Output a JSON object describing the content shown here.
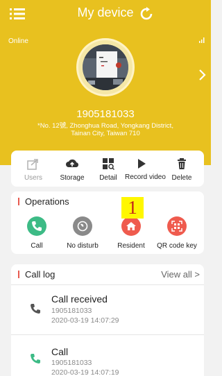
{
  "header": {
    "title": "My device",
    "status": "Online",
    "phone": "1905181033",
    "address": "*No. 12號, Zhonghua Road, Yongkang District, Tainan City, Taiwan 710",
    "icons": {
      "menu": "menu-icon",
      "refresh": "refresh-icon",
      "signal": "signal-icon",
      "next": "chevron-right-icon"
    }
  },
  "actions": [
    {
      "label": "Users",
      "icon": "share-icon",
      "disabled": true
    },
    {
      "label": "Storage",
      "icon": "cloud-upload-icon",
      "disabled": false
    },
    {
      "label": "Detail",
      "icon": "detail-icon",
      "disabled": false
    },
    {
      "label": "Record video",
      "icon": "play-icon",
      "disabled": false
    },
    {
      "label": "Delete",
      "icon": "trash-icon",
      "disabled": false
    }
  ],
  "operations": {
    "title": "Operations",
    "items": [
      {
        "label": "Call",
        "icon": "phone-icon",
        "color": "#3dbb86"
      },
      {
        "label": "No disturb",
        "icon": "no-disturb-icon",
        "color": "#8a8a8a"
      },
      {
        "label": "Resident",
        "icon": "home-icon",
        "color": "#ef5b4e"
      },
      {
        "label": "QR code key",
        "icon": "qr-code-icon",
        "color": "#ef5b4e"
      }
    ]
  },
  "annotation": {
    "badge": "1"
  },
  "call_log": {
    "title": "Call log",
    "view_all": "View all >",
    "items": [
      {
        "type": "Call received",
        "number": "1905181033",
        "time": "2020-03-19 14:07:29"
      },
      {
        "type": "Call",
        "number": "1905181033",
        "time": "2020-03-19 14:07:19"
      }
    ]
  },
  "colors": {
    "header_bg": "#e8c11f",
    "accent_red": "#e85a4f",
    "green": "#3dbb86",
    "gray": "#8a8a8a"
  }
}
